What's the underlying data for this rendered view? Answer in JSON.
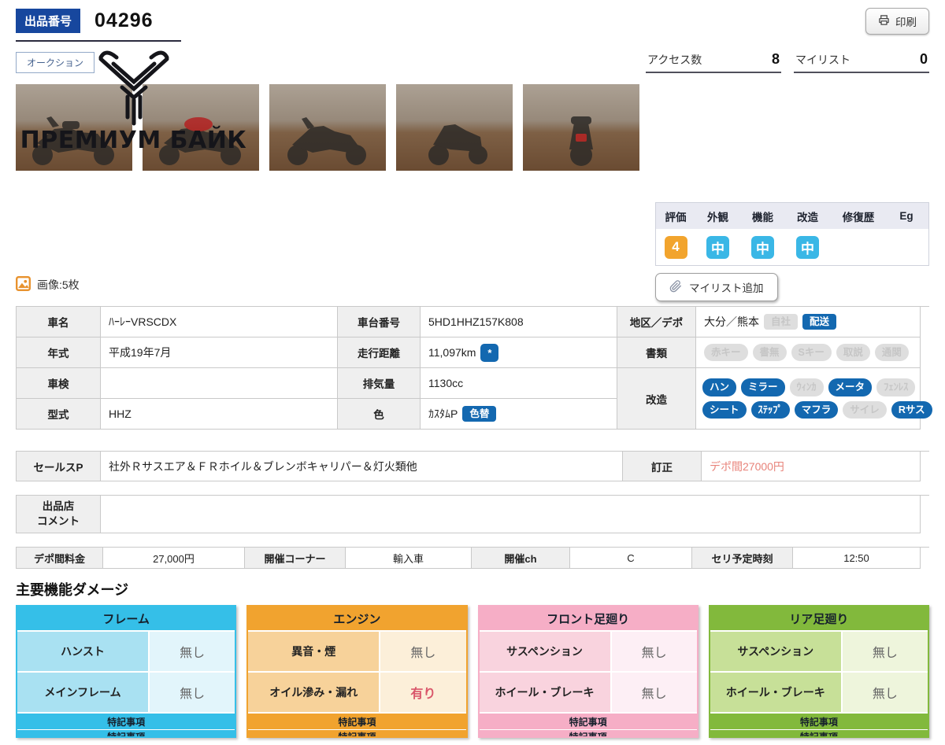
{
  "colors": {
    "lot_badge_navy": "#17479e",
    "action_blue": "#1368b0",
    "inactive_gray": "#dedede",
    "rating_orange": "#f2a42d",
    "rating_cyan": "#3ab7e6",
    "correction_red": "#e8837a",
    "damage_cyan": "#35bfe8",
    "damage_orange": "#f1a32f",
    "damage_pink": "#f6aec6",
    "damage_green": "#82b93c"
  },
  "header": {
    "lot_label": "出品番号",
    "lot_number": "04296",
    "auction_label": "オークション",
    "print_label": "印刷",
    "access_label": "アクセス数",
    "access_count": "8",
    "mylist_label": "マイリスト",
    "mylist_count": "0"
  },
  "watermark": {
    "brand": "ПРЕМИУМ БАЙК"
  },
  "gallery": {
    "count_label": "画像:5枚",
    "photo_count": 5,
    "icons": [
      "photo-thumbnail-icon"
    ]
  },
  "rating": {
    "headers": [
      "評価",
      "外観",
      "機能",
      "改造",
      "修復歴",
      "Eg"
    ],
    "values": [
      {
        "text": "4",
        "style": "orange"
      },
      {
        "text": "中",
        "style": "cyan"
      },
      {
        "text": "中",
        "style": "cyan"
      },
      {
        "text": "中",
        "style": "cyan"
      },
      {
        "text": "",
        "style": "none"
      },
      {
        "text": "",
        "style": "none"
      }
    ],
    "mylist_add_label": "マイリスト追加"
  },
  "details": {
    "vehicle_name": {
      "label": "車名",
      "value": "ﾊｰﾚｰVRSCDX"
    },
    "chassis_no": {
      "label": "車台番号",
      "value": "5HD1HHZ157K808"
    },
    "region": {
      "label": "地区／デポ",
      "value": "大分／熊本",
      "badges": [
        {
          "label": "自社",
          "active": false
        },
        {
          "label": "配送",
          "active": true
        }
      ]
    },
    "year": {
      "label": "年式",
      "value": "平成19年7月"
    },
    "mileage": {
      "label": "走行距離",
      "value": "11,097km",
      "badge": "*"
    },
    "documents": {
      "label": "書類",
      "badges": [
        {
          "label": "赤キー",
          "active": false
        },
        {
          "label": "書無",
          "active": false
        },
        {
          "label": "Sキー",
          "active": false
        },
        {
          "label": "取説",
          "active": false
        },
        {
          "label": "通関",
          "active": false
        }
      ]
    },
    "inspection": {
      "label": "車検",
      "value": ""
    },
    "displacement": {
      "label": "排気量",
      "value": "1130cc"
    },
    "modifications": {
      "label": "改造",
      "badges": [
        {
          "label": "ハン",
          "active": true
        },
        {
          "label": "ミラー",
          "active": true
        },
        {
          "label": "ｳｨﾝｶ",
          "active": false
        },
        {
          "label": "メータ",
          "active": true
        },
        {
          "label": "ﾌｪﾝﾚｽ",
          "active": false
        },
        {
          "label": "シート",
          "active": true
        },
        {
          "label": "ｽﾃｯﾌﾟ",
          "active": true
        },
        {
          "label": "マフラ",
          "active": true
        },
        {
          "label": "サイレ",
          "active": false
        },
        {
          "label": "Rサス",
          "active": true
        }
      ]
    },
    "model_code": {
      "label": "型式",
      "value": "HHZ"
    },
    "color": {
      "label": "色",
      "value": "ｶｽﾀﾑP",
      "badge": "色替"
    }
  },
  "sales": {
    "label": "セールスP",
    "value": "社外Ｒサスエア＆ＦＲホイル＆ブレンボキャリパー＆灯火類他",
    "correction_label": "訂正",
    "correction_value": "デポ間27000円"
  },
  "comment": {
    "label_line1": "出品店",
    "label_line2": "コメント",
    "value": ""
  },
  "fee": {
    "cells": [
      {
        "kind": "label",
        "text": "デポ間料金"
      },
      {
        "kind": "value",
        "text": "27,000円"
      },
      {
        "kind": "label",
        "text": "開催コーナー"
      },
      {
        "kind": "value",
        "text": "輸入車"
      },
      {
        "kind": "label",
        "text": "開催ch"
      },
      {
        "kind": "value",
        "text": "C"
      },
      {
        "kind": "label",
        "text": "セリ予定時刻"
      },
      {
        "kind": "value",
        "text": "12:50"
      }
    ]
  },
  "damage": {
    "heading": "主要機能ダメージ",
    "footer_label": "特記事項",
    "columns": [
      {
        "title": "フレーム",
        "theme": "cyan",
        "rows": [
          {
            "label": "ハンスト",
            "value": "無し",
            "flagged": false
          },
          {
            "label": "メインフレーム",
            "value": "無し",
            "flagged": false
          }
        ]
      },
      {
        "title": "エンジン",
        "theme": "orange",
        "rows": [
          {
            "label": "異音・煙",
            "value": "無し",
            "flagged": false
          },
          {
            "label": "オイル滲み・漏れ",
            "value": "有り",
            "flagged": true
          }
        ]
      },
      {
        "title": "フロント足廻り",
        "theme": "pink",
        "rows": [
          {
            "label": "サスペンション",
            "value": "無し",
            "flagged": false
          },
          {
            "label": "ホイール・ブレーキ",
            "value": "無し",
            "flagged": false
          }
        ]
      },
      {
        "title": "リア足廻り",
        "theme": "green",
        "rows": [
          {
            "label": "サスペンション",
            "value": "無し",
            "flagged": false
          },
          {
            "label": "ホイール・ブレーキ",
            "value": "無し",
            "flagged": false
          }
        ]
      }
    ]
  }
}
